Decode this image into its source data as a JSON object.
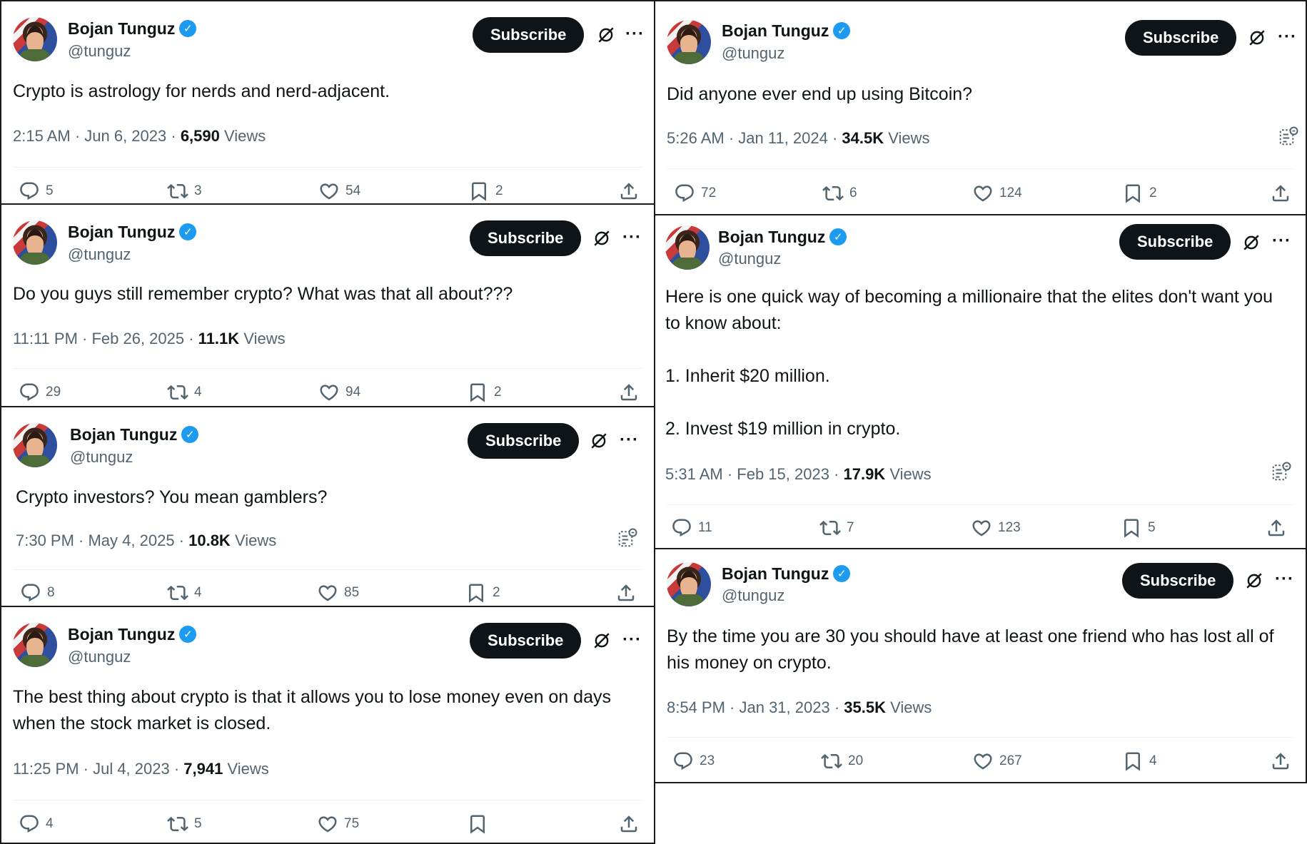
{
  "author": {
    "name": "Bojan Tunguz",
    "handle": "@tunguz",
    "verified_glyph": "✓"
  },
  "subscribe_label": "Subscribe",
  "more_label": "···",
  "views_label": "Views",
  "colors": {
    "subscribe_bg": "#0f1419",
    "verified": "#1d9bf0",
    "muted": "#536471"
  },
  "tweets": [
    {
      "text": "Crypto is astrology for nerds and nerd-adjacent.",
      "time": "2:15 AM · Jun 6, 2023 · ",
      "views": "6,590",
      "replies": "5",
      "reposts": "3",
      "likes": "54",
      "bookmarks": "2"
    },
    {
      "text": "Do you guys still remember crypto? What was that all about???",
      "time": "11:11 PM · Feb 26, 2025 · ",
      "views": "11.1K",
      "replies": "29",
      "reposts": "4",
      "likes": "94",
      "bookmarks": "2"
    },
    {
      "text": "Crypto investors? You mean gamblers?",
      "time": "7:30 PM · May 4, 2025 · ",
      "views": "10.8K",
      "replies": "8",
      "reposts": "4",
      "likes": "85",
      "bookmarks": "2"
    },
    {
      "text": "The best thing about crypto is that it allows you to lose money even on days when the stock market is closed.",
      "time": "11:25 PM · Jul 4, 2023 · ",
      "views": "7,941",
      "replies": "4",
      "reposts": "5",
      "likes": "75",
      "bookmarks": ""
    },
    {
      "text": "Did anyone ever end up using Bitcoin?",
      "time": "5:26 AM · Jan 11, 2024 · ",
      "views": "34.5K",
      "replies": "72",
      "reposts": "6",
      "likes": "124",
      "bookmarks": "2"
    },
    {
      "text": "Here is one quick way of becoming a millionaire that the elites don't want you to know about:\n\n1. Inherit $20 million.\n\n2. Invest $19 million in crypto.",
      "time": "5:31 AM · Feb 15, 2023 · ",
      "views": "17.9K",
      "replies": "11",
      "reposts": "7",
      "likes": "123",
      "bookmarks": "5"
    },
    {
      "text": "By the time you are 30 you should have at least one friend who has lost all of his money on crypto.",
      "time": "8:54 PM · Jan 31, 2023 · ",
      "views": "35.5K",
      "replies": "23",
      "reposts": "20",
      "likes": "267",
      "bookmarks": "4"
    }
  ]
}
